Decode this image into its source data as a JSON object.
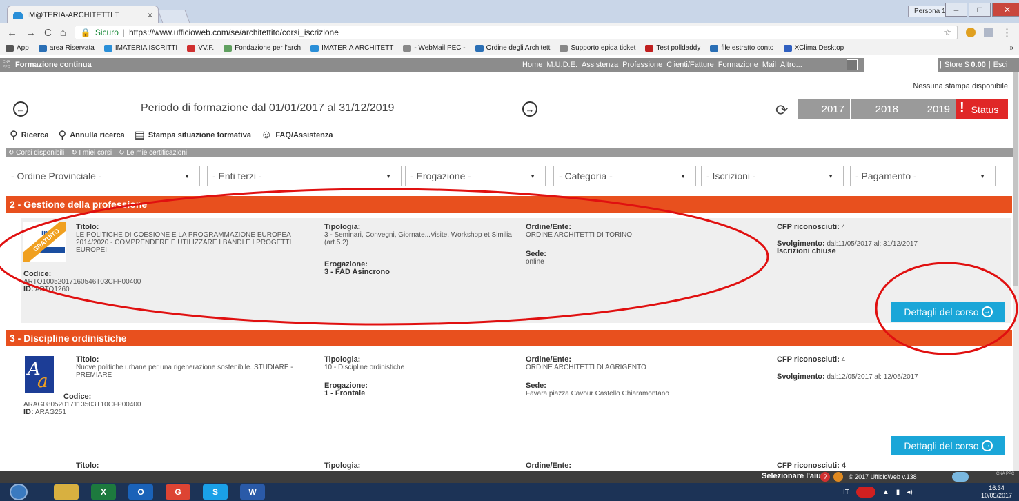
{
  "browser": {
    "tab_title": "IM@TERIA-ARCHITETTI T",
    "tab_close": "×",
    "persona": "Persona 1",
    "win_min": "–",
    "win_max": "□",
    "win_close": "✕",
    "secure_label": "Sicuro",
    "url": "https://www.ufficioweb.com/se/architettito/corsi_iscrizione",
    "bookmarks": [
      {
        "label": "App",
        "color": "#555555"
      },
      {
        "label": "area Riservata",
        "color": "#2a6fb5"
      },
      {
        "label": "IMATERIA ISCRITTI",
        "color": "#2a8fd8"
      },
      {
        "label": "VV.F.",
        "color": "#d03030"
      },
      {
        "label": "Fondazione per l'arch",
        "color": "#60a060"
      },
      {
        "label": "IMATERIA ARCHITETT",
        "color": "#2a8fd8"
      },
      {
        "label": "- WebMail PEC -",
        "color": "#888888"
      },
      {
        "label": "Ordine degli Architett",
        "color": "#2a6fb5"
      },
      {
        "label": "Supporto epida ticket",
        "color": "#888888"
      },
      {
        "label": "Test polldaddy",
        "color": "#c02020"
      },
      {
        "label": "file estratto conto",
        "color": "#2a6fb5"
      },
      {
        "label": "XClima Desktop",
        "color": "#3060c0"
      }
    ],
    "bookmarks_more": "»"
  },
  "header": {
    "logo_text": "CNA PPC",
    "brand": "Formazione continua",
    "menu": [
      "Home",
      "M.U.D.E.",
      "Assistenza",
      "Professione",
      "Clienti/Fatture",
      "Formazione",
      "Mail",
      "Altro..."
    ],
    "store_label": "Store $",
    "store_amount": "0.00",
    "store_sep": "|",
    "exit": "Esci"
  },
  "page": {
    "no_print": "Nessuna stampa disponibile.",
    "period": "Periodo di formazione dal 01/01/2017 al 31/12/2019",
    "prev": "←",
    "next": "→",
    "refresh": "⟳",
    "years": [
      "2017",
      "2018",
      "2019"
    ],
    "status_bang": "!",
    "status": "Status"
  },
  "toolbar": {
    "search": "Ricerca",
    "reset": "Annulla ricerca",
    "print": "Stampa situazione formativa",
    "faq": "FAQ/Assistenza"
  },
  "subtabs": [
    "Corsi disponibili",
    "I miei corsi",
    "Le mie certificazioni"
  ],
  "filters": [
    "- Ordine Provinciale -",
    "- Enti terzi -",
    "- Erogazione -",
    "- Categoria -",
    "- Iscrizioni -",
    "- Pagamento -"
  ],
  "labels": {
    "titolo": "Titolo:",
    "codice": "Codice:",
    "id": "ID:",
    "tipologia": "Tipologia:",
    "erogazione": "Erogazione:",
    "ordine": "Ordine/Ente:",
    "sede": "Sede:",
    "cfp": "CFP riconosciuti:",
    "svolgimento": "Svolgimento:",
    "details_btn": "Dettagli del corso"
  },
  "sections": [
    {
      "title": "2 - Gestione della professione",
      "course": {
        "badge": "GRATUITO",
        "logo_text": "ine",
        "titolo": "LE POLITICHE DI COESIONE E LA PROGRAMMAZIONE EUROPEA 2014/2020 - COMPRENDERE E UTILIZZARE I BANDI E I PROGETTI EUROPEI",
        "codice": "ARTO10052017160546T03CFP00400",
        "id": "ARTO1260",
        "tipologia": "3 - Seminari, Convegni, Giornate...Visite, Workshop et Similia (art.5.2)",
        "erogazione": "3 - FAD Asincrono",
        "ordine": "ORDINE ARCHITETTI DI TORINO",
        "sede": "online",
        "cfp": "4",
        "svolgimento": "dal:11/05/2017 al: 31/12/2017",
        "note": "Iscrizioni chiuse"
      }
    },
    {
      "title": "3 - Discipline ordinistiche",
      "course": {
        "logo_a": "A",
        "logo_c": "a",
        "titolo": "Nuove politiche urbane per una rigenerazione sostenibile. STUDIARE - PREMIARE",
        "codice": "ARAG08052017113503T10CFP00400",
        "id": "ARAG251",
        "tipologia": "10 - Discipline ordinistiche",
        "erogazione": "1 - Frontale",
        "ordine": "ORDINE ARCHITETTI DI AGRIGENTO",
        "sede": "Favara piazza Cavour Castello Chiaramontano",
        "cfp": "4",
        "svolgimento": "dal:12/05/2017 al: 12/05/2017"
      }
    }
  ],
  "peek": {
    "titolo": "Titolo:",
    "tipologia": "Tipologia:",
    "ordine": "Ordine/Ente:",
    "cfp": "CFP riconosciuti: 4"
  },
  "footer": {
    "help": "Selezionare l'aiuto",
    "help_q": "?",
    "copyright": "© 2017 UfficioWeb v.138",
    "cna": "CNA PPC"
  },
  "taskbar": {
    "apps": [
      {
        "label": "",
        "color": "#d8b040"
      },
      {
        "label": "X",
        "color": "#1d7a3e"
      },
      {
        "label": "O",
        "color": "#1a62b8"
      },
      {
        "label": "G",
        "color": "#dd4433"
      },
      {
        "label": "S",
        "color": "#1aa0e8"
      },
      {
        "label": "W",
        "color": "#2a5aa8"
      }
    ],
    "lang": "IT",
    "time": "16:34",
    "date": "10/05/2017"
  },
  "colors": {
    "section_bar": "#e8501e",
    "details_btn": "#1aa6d8",
    "status": "#e02727",
    "annotation": "#e01010"
  }
}
